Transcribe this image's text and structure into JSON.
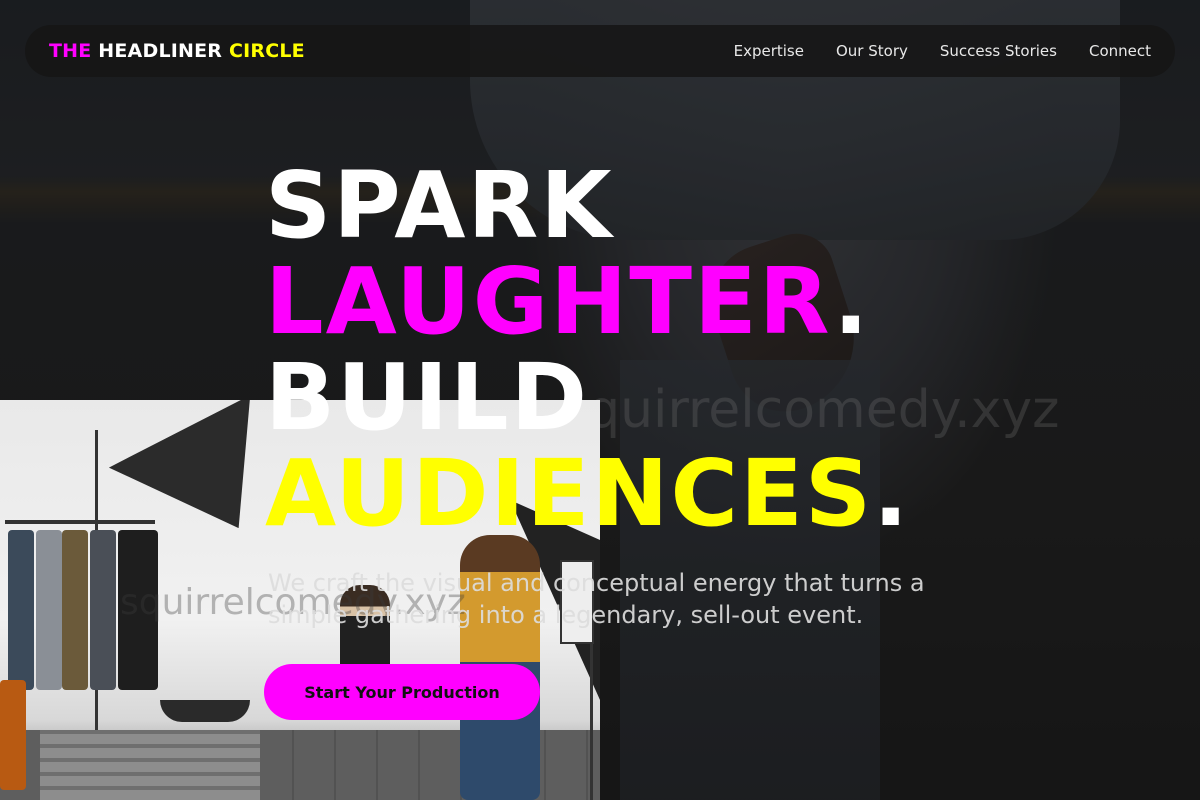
{
  "nav": {
    "logo": {
      "part1": "THE",
      "part2": "HEADLINER",
      "part3": "CIRCLE"
    },
    "links": [
      "Expertise",
      "Our Story",
      "Success Stories",
      "Connect"
    ]
  },
  "hero": {
    "line1": "SPARK",
    "line2_word": "LAUGHTER",
    "line2_punct": ".",
    "line3": "BUILD",
    "line4_word": "AUDIENCES",
    "line4_punct": ".",
    "subtitle": "We craft the visual and conceptual energy that turns a simple gathering into a legendary, sell-out event.",
    "cta_label": "Start Your Production"
  },
  "watermarks": [
    "squirrelcomedy.xyz",
    "squirrelcomedy.xyz"
  ],
  "colors": {
    "magenta": "#ff00ff",
    "yellow": "#ffff00",
    "nav_bg": "#161616"
  }
}
